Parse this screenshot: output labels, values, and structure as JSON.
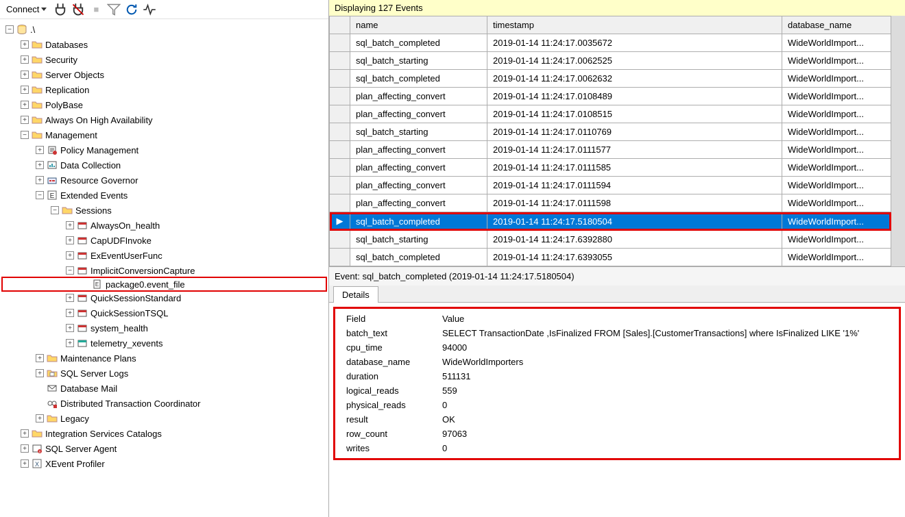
{
  "toolbar": {
    "connect_label": "Connect"
  },
  "tree": {
    "root_label": ".\\",
    "nodes": [
      {
        "indent": 1,
        "exp": "+",
        "icon": "folder",
        "label": "Databases"
      },
      {
        "indent": 1,
        "exp": "+",
        "icon": "folder",
        "label": "Security"
      },
      {
        "indent": 1,
        "exp": "+",
        "icon": "folder",
        "label": "Server Objects"
      },
      {
        "indent": 1,
        "exp": "+",
        "icon": "folder",
        "label": "Replication"
      },
      {
        "indent": 1,
        "exp": "+",
        "icon": "folder",
        "label": "PolyBase"
      },
      {
        "indent": 1,
        "exp": "+",
        "icon": "folder",
        "label": "Always On High Availability"
      },
      {
        "indent": 1,
        "exp": "-",
        "icon": "folder",
        "label": "Management"
      },
      {
        "indent": 2,
        "exp": "+",
        "icon": "policy",
        "label": "Policy Management"
      },
      {
        "indent": 2,
        "exp": "+",
        "icon": "datacol",
        "label": "Data Collection"
      },
      {
        "indent": 2,
        "exp": "+",
        "icon": "resgov",
        "label": "Resource Governor"
      },
      {
        "indent": 2,
        "exp": "-",
        "icon": "xe",
        "label": "Extended Events"
      },
      {
        "indent": 3,
        "exp": "-",
        "icon": "folder",
        "label": "Sessions"
      },
      {
        "indent": 4,
        "exp": "+",
        "icon": "sess",
        "label": "AlwaysOn_health"
      },
      {
        "indent": 4,
        "exp": "+",
        "icon": "sess",
        "label": "CapUDFInvoke"
      },
      {
        "indent": 4,
        "exp": "+",
        "icon": "sess",
        "label": "ExEventUserFunc"
      },
      {
        "indent": 4,
        "exp": "-",
        "icon": "sess",
        "label": "ImplicitConversionCapture"
      },
      {
        "indent": 5,
        "exp": " ",
        "icon": "file",
        "label": "package0.event_file",
        "highlight": true
      },
      {
        "indent": 4,
        "exp": "+",
        "icon": "sess",
        "label": "QuickSessionStandard"
      },
      {
        "indent": 4,
        "exp": "+",
        "icon": "sess",
        "label": "QuickSessionTSQL"
      },
      {
        "indent": 4,
        "exp": "+",
        "icon": "sess",
        "label": "system_health"
      },
      {
        "indent": 4,
        "exp": "+",
        "icon": "sess-g",
        "label": "telemetry_xevents"
      },
      {
        "indent": 2,
        "exp": "+",
        "icon": "folder",
        "label": "Maintenance Plans"
      },
      {
        "indent": 2,
        "exp": "+",
        "icon": "folder-doc",
        "label": "SQL Server Logs"
      },
      {
        "indent": 2,
        "exp": " ",
        "icon": "mail",
        "label": "Database Mail"
      },
      {
        "indent": 2,
        "exp": " ",
        "icon": "dtc",
        "label": "Distributed Transaction Coordinator"
      },
      {
        "indent": 2,
        "exp": "+",
        "icon": "folder",
        "label": "Legacy"
      },
      {
        "indent": 1,
        "exp": "+",
        "icon": "folder",
        "label": "Integration Services Catalogs"
      },
      {
        "indent": 1,
        "exp": "+",
        "icon": "sqlagent",
        "label": "SQL Server Agent"
      },
      {
        "indent": 1,
        "exp": "+",
        "icon": "xprof",
        "label": "XEvent Profiler"
      }
    ]
  },
  "events": {
    "header": "Displaying 127 Events",
    "columns": [
      "name",
      "timestamp",
      "database_name"
    ],
    "rows": [
      {
        "name": "sql_batch_completed",
        "timestamp": "2019-01-14 11:24:17.0035672",
        "db": "WideWorldImport..."
      },
      {
        "name": "sql_batch_starting",
        "timestamp": "2019-01-14 11:24:17.0062525",
        "db": "WideWorldImport..."
      },
      {
        "name": "sql_batch_completed",
        "timestamp": "2019-01-14 11:24:17.0062632",
        "db": "WideWorldImport..."
      },
      {
        "name": "plan_affecting_convert",
        "timestamp": "2019-01-14 11:24:17.0108489",
        "db": "WideWorldImport..."
      },
      {
        "name": "plan_affecting_convert",
        "timestamp": "2019-01-14 11:24:17.0108515",
        "db": "WideWorldImport..."
      },
      {
        "name": "sql_batch_starting",
        "timestamp": "2019-01-14 11:24:17.0110769",
        "db": "WideWorldImport..."
      },
      {
        "name": "plan_affecting_convert",
        "timestamp": "2019-01-14 11:24:17.0111577",
        "db": "WideWorldImport..."
      },
      {
        "name": "plan_affecting_convert",
        "timestamp": "2019-01-14 11:24:17.0111585",
        "db": "WideWorldImport..."
      },
      {
        "name": "plan_affecting_convert",
        "timestamp": "2019-01-14 11:24:17.0111594",
        "db": "WideWorldImport..."
      },
      {
        "name": "plan_affecting_convert",
        "timestamp": "2019-01-14 11:24:17.0111598",
        "db": "WideWorldImport..."
      },
      {
        "name": "sql_batch_completed",
        "timestamp": "2019-01-14 11:24:17.5180504",
        "db": "WideWorldImport...",
        "selected": true
      },
      {
        "name": "sql_batch_starting",
        "timestamp": "2019-01-14 11:24:17.6392880",
        "db": "WideWorldImport..."
      },
      {
        "name": "sql_batch_completed",
        "timestamp": "2019-01-14 11:24:17.6393055",
        "db": "WideWorldImport..."
      }
    ]
  },
  "detail": {
    "title": "Event: sql_batch_completed (2019-01-14 11:24:17.5180504)",
    "tab_label": "Details",
    "field_header": "Field",
    "value_header": "Value",
    "fields": [
      {
        "field": "batch_text",
        "value": "SELECT TransactionDate     ,IsFinalized   FROM [Sales].[CustomerTransactions]  where IsFinalized  LIKE '1%'"
      },
      {
        "field": "cpu_time",
        "value": "94000"
      },
      {
        "field": "database_name",
        "value": "WideWorldImporters"
      },
      {
        "field": "duration",
        "value": "511131"
      },
      {
        "field": "logical_reads",
        "value": "559"
      },
      {
        "field": "physical_reads",
        "value": "0"
      },
      {
        "field": "result",
        "value": "OK"
      },
      {
        "field": "row_count",
        "value": "97063"
      },
      {
        "field": "writes",
        "value": "0"
      }
    ]
  }
}
